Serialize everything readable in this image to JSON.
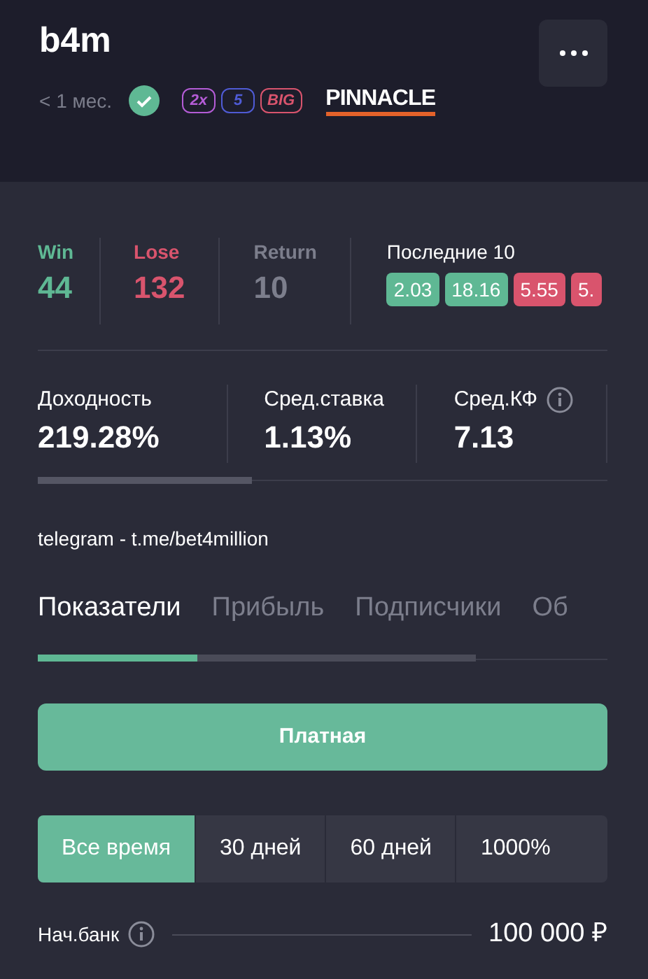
{
  "title": "b4m",
  "meta": {
    "age": "< 1 мес.",
    "verified": true,
    "badges": [
      {
        "label": "2x",
        "color": "#b45cd6"
      },
      {
        "label": "5",
        "color": "#4f5bd5"
      },
      {
        "label": "BIG",
        "color": "#d9546d"
      }
    ],
    "bookmaker": "PINNACLE"
  },
  "results": [
    {
      "label": "Win",
      "value": "44",
      "color": "#5fb894"
    },
    {
      "label": "Lose",
      "value": "132",
      "color": "#d9546d"
    },
    {
      "label": "Return",
      "value": "10",
      "color": "#7c7e8c"
    }
  ],
  "last10": {
    "label": "Последние 10",
    "items": [
      {
        "value": "2.03",
        "color": "#5fb894"
      },
      {
        "value": "18.16",
        "color": "#5fb894"
      },
      {
        "value": "5.55",
        "color": "#d9546d"
      },
      {
        "value": "5.",
        "color": "#d9546d"
      }
    ]
  },
  "metrics": [
    {
      "label": "Доходность",
      "value": "219.28%",
      "info": false
    },
    {
      "label": "Сред.ставка",
      "value": "1.13%",
      "info": false
    },
    {
      "label": "Сред.КФ",
      "value": "7.13",
      "info": true
    }
  ],
  "link": "telegram - t.me/bet4million",
  "tabs": [
    {
      "label": "Показатели",
      "selected": true
    },
    {
      "label": "Прибыль",
      "selected": false
    },
    {
      "label": "Подписчики",
      "selected": false
    },
    {
      "label": "Об",
      "selected": false
    }
  ],
  "access_button": "Платная",
  "periods": [
    {
      "label": "Все время",
      "selected": true
    },
    {
      "label": "30 дней",
      "selected": false
    },
    {
      "label": "60 дней",
      "selected": false
    },
    {
      "label": "1000%",
      "selected": false
    }
  ],
  "bank": {
    "label": "Нач.банк",
    "value": "100 000 ₽"
  }
}
